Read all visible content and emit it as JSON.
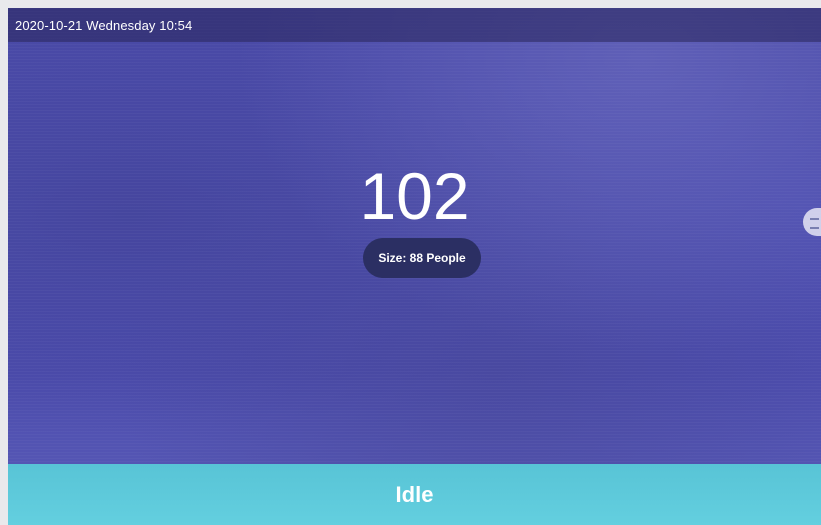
{
  "status_bar": {
    "datetime": "2020-10-21 Wednesday 10:54"
  },
  "main": {
    "count": "102",
    "size_label": "Size: 88 People"
  },
  "footer": {
    "status": "Idle"
  },
  "icons": {
    "side_handle": "menu-handle-icon"
  },
  "colors": {
    "background": "#4c4cad",
    "status_bar": "#2e2a63",
    "pill": "#2b2f63",
    "status_panel": "#5fc9da",
    "text": "#ffffff"
  }
}
